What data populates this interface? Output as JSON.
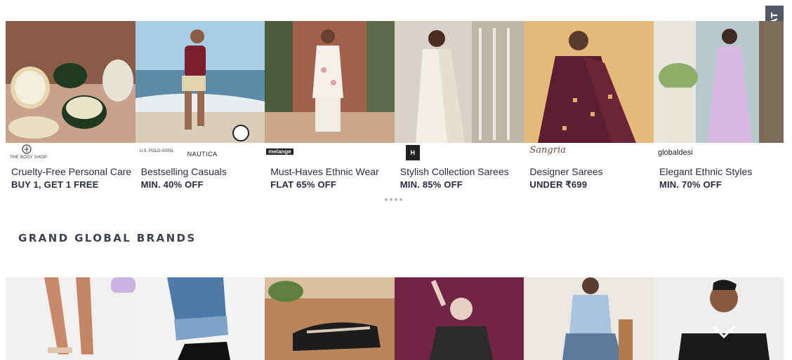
{
  "flat_tab": {
    "label": "FLAT"
  },
  "cards": [
    {
      "brand": "THE BODY SHOP",
      "title": "Cruelty-Free Personal Care",
      "offer": "BUY 1, GET 1 FREE"
    },
    {
      "brand": "U.S. POLO ASSN.",
      "brand2": "NAUTICA",
      "title": "Bestselling Casuals",
      "offer": "MIN. 40% OFF"
    },
    {
      "brand": "melange",
      "title": "Must-Haves Ethnic Wear",
      "offer": "FLAT 65% OFF"
    },
    {
      "brand": "H",
      "title": "Stylish Collection Sarees",
      "offer": "MIN. 85% OFF"
    },
    {
      "brand": "Sangria",
      "title": "Designer Sarees",
      "offer": "UNDER ₹699"
    },
    {
      "brand": "globaldesi",
      "title": "Elegant Ethnic Styles",
      "offer": "MIN. 70% OFF"
    }
  ],
  "carousel": {
    "dot_count": 4
  },
  "section": {
    "heading": "GRAND GLOBAL BRANDS"
  }
}
